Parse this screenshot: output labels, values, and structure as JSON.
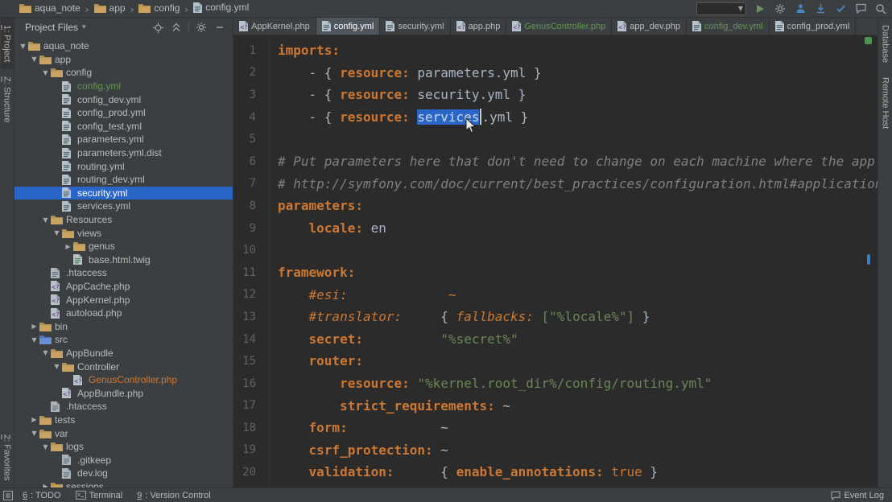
{
  "top_bar": {
    "breadcrumbs": [
      {
        "label": "aqua_note",
        "icon": "folder"
      },
      {
        "label": "app",
        "icon": "folder"
      },
      {
        "label": "config",
        "icon": "folder"
      },
      {
        "label": "config.yml",
        "icon": "yml"
      }
    ],
    "toolbar_icons": [
      {
        "name": "run"
      },
      {
        "name": "settings"
      },
      {
        "name": "user"
      },
      {
        "name": "vcs-update"
      },
      {
        "name": "vcs-commit"
      },
      {
        "name": "messages"
      },
      {
        "name": "search"
      }
    ]
  },
  "tabs": [
    {
      "label": "AppKernel.php",
      "type": "php",
      "active": false,
      "color": "default"
    },
    {
      "label": "config.yml",
      "type": "yml",
      "active": true,
      "color": "default"
    },
    {
      "label": "security.yml",
      "type": "yml",
      "active": false,
      "color": "default"
    },
    {
      "label": "app.php",
      "type": "php",
      "active": false,
      "color": "default"
    },
    {
      "label": "GenusController.php",
      "type": "php",
      "active": false,
      "color": "green"
    },
    {
      "label": "app_dev.php",
      "type": "php",
      "active": false,
      "color": "default"
    },
    {
      "label": "config_dev.yml",
      "type": "yml",
      "active": false,
      "color": "green"
    },
    {
      "label": "config_prod.yml",
      "type": "yml",
      "active": false,
      "color": "default"
    }
  ],
  "project_panel": {
    "title": "Project Files",
    "header_icons": [
      {
        "name": "locate"
      },
      {
        "name": "collapse-all"
      },
      {
        "name": "settings"
      },
      {
        "name": "hide"
      }
    ],
    "tree": [
      {
        "label": "aqua_note",
        "depth": 0,
        "icon": "folder",
        "arrow": "open"
      },
      {
        "label": "app",
        "depth": 1,
        "icon": "folder",
        "arrow": "open"
      },
      {
        "label": "config",
        "depth": 2,
        "icon": "folder",
        "arrow": "open"
      },
      {
        "label": "config.yml",
        "depth": 3,
        "icon": "yml",
        "color": "green"
      },
      {
        "label": "config_dev.yml",
        "depth": 3,
        "icon": "yml"
      },
      {
        "label": "config_prod.yml",
        "depth": 3,
        "icon": "yml"
      },
      {
        "label": "config_test.yml",
        "depth": 3,
        "icon": "yml"
      },
      {
        "label": "parameters.yml",
        "depth": 3,
        "icon": "yml"
      },
      {
        "label": "parameters.yml.dist",
        "depth": 3,
        "icon": "yml"
      },
      {
        "label": "routing.yml",
        "depth": 3,
        "icon": "yml"
      },
      {
        "label": "routing_dev.yml",
        "depth": 3,
        "icon": "yml"
      },
      {
        "label": "security.yml",
        "depth": 3,
        "icon": "yml",
        "selected": true
      },
      {
        "label": "services.yml",
        "depth": 3,
        "icon": "yml"
      },
      {
        "label": "Resources",
        "depth": 2,
        "icon": "folder",
        "arrow": "open"
      },
      {
        "label": "views",
        "depth": 3,
        "icon": "folder",
        "arrow": "open"
      },
      {
        "label": "genus",
        "depth": 4,
        "icon": "folder",
        "arrow": "closed"
      },
      {
        "label": "base.html.twig",
        "depth": 4,
        "icon": "twig"
      },
      {
        "label": ".htaccess",
        "depth": 2,
        "icon": "file"
      },
      {
        "label": "AppCache.php",
        "depth": 2,
        "icon": "php"
      },
      {
        "label": "AppKernel.php",
        "depth": 2,
        "icon": "php"
      },
      {
        "label": "autoload.php",
        "depth": 2,
        "icon": "php"
      },
      {
        "label": "bin",
        "depth": 1,
        "icon": "folder",
        "arrow": "closed"
      },
      {
        "label": "src",
        "depth": 1,
        "icon": "folder-src",
        "arrow": "open"
      },
      {
        "label": "AppBundle",
        "depth": 2,
        "icon": "folder",
        "arrow": "open"
      },
      {
        "label": "Controller",
        "depth": 3,
        "icon": "folder",
        "arrow": "open"
      },
      {
        "label": "GenusController.php",
        "depth": 4,
        "icon": "php",
        "color": "orange"
      },
      {
        "label": "AppBundle.php",
        "depth": 3,
        "icon": "php"
      },
      {
        "label": ".htaccess",
        "depth": 2,
        "icon": "file"
      },
      {
        "label": "tests",
        "depth": 1,
        "icon": "folder",
        "arrow": "closed"
      },
      {
        "label": "var",
        "depth": 1,
        "icon": "folder",
        "arrow": "open"
      },
      {
        "label": "logs",
        "depth": 2,
        "icon": "folder",
        "arrow": "open"
      },
      {
        "label": ".gitkeep",
        "depth": 3,
        "icon": "file"
      },
      {
        "label": "dev.log",
        "depth": 3,
        "icon": "file"
      },
      {
        "label": "sessions",
        "depth": 2,
        "icon": "folder",
        "arrow": "closed"
      }
    ]
  },
  "editor": {
    "selection_text": "services",
    "lines": [
      {
        "segs": [
          [
            "k",
            "imports:"
          ]
        ]
      },
      {
        "segs": [
          [
            "d",
            "    - { "
          ],
          [
            "k",
            "resource: "
          ],
          [
            "d",
            "parameters.yml }"
          ]
        ]
      },
      {
        "segs": [
          [
            "d",
            "    - { "
          ],
          [
            "k",
            "resource: "
          ],
          [
            "d",
            "security.yml }"
          ]
        ]
      },
      {
        "segs": [
          [
            "d",
            "    - { "
          ],
          [
            "k",
            "resource: "
          ],
          [
            "sel",
            "services"
          ],
          [
            "caret",
            ""
          ],
          [
            "d",
            ".yml }"
          ]
        ]
      },
      {
        "segs": []
      },
      {
        "segs": [
          [
            "c",
            "# Put parameters here that don't need to change on each machine where the app"
          ]
        ]
      },
      {
        "segs": [
          [
            "c",
            "# http://symfony.com/doc/current/best_practices/configuration.html#application"
          ]
        ]
      },
      {
        "segs": [
          [
            "k",
            "parameters:"
          ]
        ]
      },
      {
        "segs": [
          [
            "d",
            "    "
          ],
          [
            "k",
            "locale: "
          ],
          [
            "d",
            "en"
          ]
        ]
      },
      {
        "segs": []
      },
      {
        "segs": [
          [
            "k",
            "framework:"
          ]
        ]
      },
      {
        "segs": [
          [
            "d",
            "    "
          ],
          [
            "ck",
            "#esi:"
          ],
          [
            "d",
            "             "
          ],
          [
            "ck",
            "~"
          ]
        ]
      },
      {
        "segs": [
          [
            "d",
            "    "
          ],
          [
            "ck",
            "#translator:"
          ],
          [
            "d",
            "     { "
          ],
          [
            "ck",
            "fallbacks: "
          ],
          [
            "s",
            "[\"%locale%\"]"
          ],
          [
            "d",
            " }"
          ]
        ]
      },
      {
        "segs": [
          [
            "d",
            "    "
          ],
          [
            "k",
            "secret:"
          ],
          [
            "d",
            "          "
          ],
          [
            "s",
            "\"%secret%\""
          ]
        ]
      },
      {
        "segs": [
          [
            "d",
            "    "
          ],
          [
            "k",
            "router:"
          ]
        ]
      },
      {
        "segs": [
          [
            "d",
            "        "
          ],
          [
            "k",
            "resource: "
          ],
          [
            "s",
            "\"%kernel.root_dir%/config/routing.yml\""
          ]
        ]
      },
      {
        "segs": [
          [
            "d",
            "        "
          ],
          [
            "k",
            "strict_requirements: "
          ],
          [
            "d",
            "~"
          ]
        ]
      },
      {
        "segs": [
          [
            "d",
            "    "
          ],
          [
            "k",
            "form:"
          ],
          [
            "d",
            "            ~"
          ]
        ]
      },
      {
        "segs": [
          [
            "d",
            "    "
          ],
          [
            "k",
            "csrf_protection: "
          ],
          [
            "d",
            "~"
          ]
        ]
      },
      {
        "segs": [
          [
            "d",
            "    "
          ],
          [
            "k",
            "validation:"
          ],
          [
            "d",
            "      { "
          ],
          [
            "k",
            "enable_annotations: "
          ],
          [
            "kw",
            "true"
          ],
          [
            "d",
            " }"
          ]
        ]
      }
    ]
  },
  "stripes": {
    "left_top": [
      {
        "mnemonic": "1",
        "label": ": Project",
        "active": true
      },
      {
        "mnemonic": "Z",
        "label": ": Structure",
        "active": false
      }
    ],
    "left_bottom": [
      {
        "mnemonic": "2",
        "label": ": Favorites",
        "active": false
      }
    ],
    "right": [
      {
        "label": "Database"
      },
      {
        "label": "Remote Host"
      }
    ]
  },
  "status_bar": {
    "items_left": [
      {
        "mnemonic": "6",
        "label": ": TODO"
      },
      {
        "label": "Terminal",
        "icon": "terminal"
      },
      {
        "mnemonic": "9",
        "label": ": Version Control"
      }
    ],
    "items_right": [
      {
        "label": "Event Log",
        "icon": "event"
      }
    ]
  },
  "colors": {
    "selection": "#2966c8",
    "key": "#cc7832",
    "string": "#6a8759",
    "comment": "#808080",
    "tab_active_bg": "#4e565c",
    "vcs_green": "#629755",
    "vcs_orange": "#cc7832"
  }
}
